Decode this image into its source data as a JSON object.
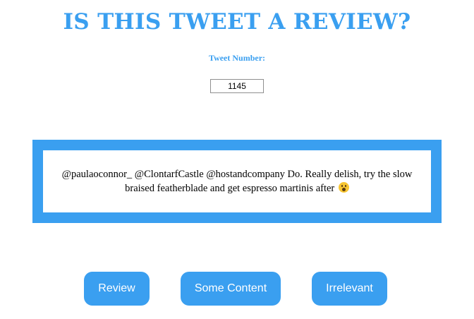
{
  "header": {
    "title": "IS THIS TWEET A REVIEW?"
  },
  "tweet_number": {
    "label": "Tweet Number:",
    "value": "1145"
  },
  "tweet": {
    "text": "@paulaoconnor_ @ClontarfCastle @hostandcompany Do. Really delish, try the slow braised featherblade and get espresso martinis after",
    "emoji_icon": "astonished-face-emoji"
  },
  "buttons": {
    "review": "Review",
    "some_content": "Some Content",
    "irrelevant": "Irrelevant"
  },
  "colors": {
    "accent": "#3a9ff0",
    "background": "#ffffff"
  }
}
